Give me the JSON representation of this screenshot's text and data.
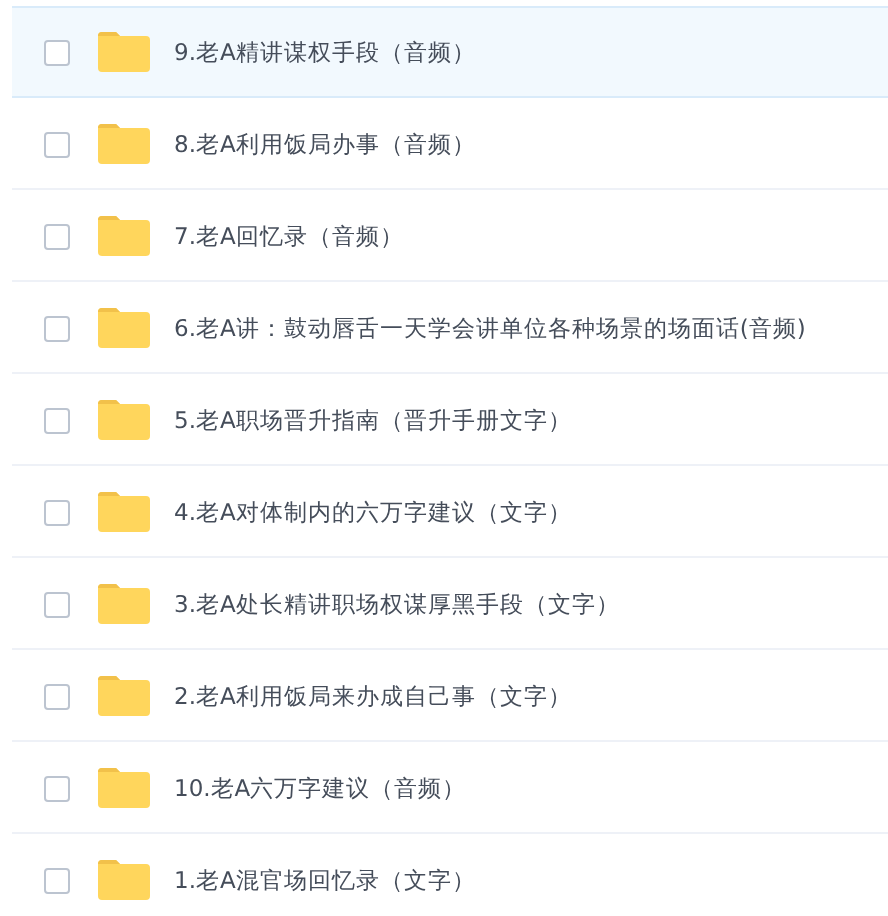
{
  "files": [
    {
      "name": "9.老A精讲谋权手段（音频）",
      "selected": true,
      "checked": false
    },
    {
      "name": "8.老A利用饭局办事（音频）",
      "selected": false,
      "checked": false
    },
    {
      "name": "7.老A回忆录（音频）",
      "selected": false,
      "checked": false
    },
    {
      "name": "6.老A讲：鼓动唇舌一天学会讲单位各种场景的场面话(音频)",
      "selected": false,
      "checked": false
    },
    {
      "name": "5.老A职场晋升指南（晋升手册文字）",
      "selected": false,
      "checked": false
    },
    {
      "name": "4.老A对体制内的六万字建议（文字）",
      "selected": false,
      "checked": false
    },
    {
      "name": "3.老A处长精讲职场权谋厚黑手段（文字）",
      "selected": false,
      "checked": false
    },
    {
      "name": "2.老A利用饭局来办成自己事（文字）",
      "selected": false,
      "checked": false
    },
    {
      "name": "10.老A六万字建议（音频）",
      "selected": false,
      "checked": false
    },
    {
      "name": "1.老A混官场回忆录（文字）",
      "selected": false,
      "checked": false
    }
  ]
}
